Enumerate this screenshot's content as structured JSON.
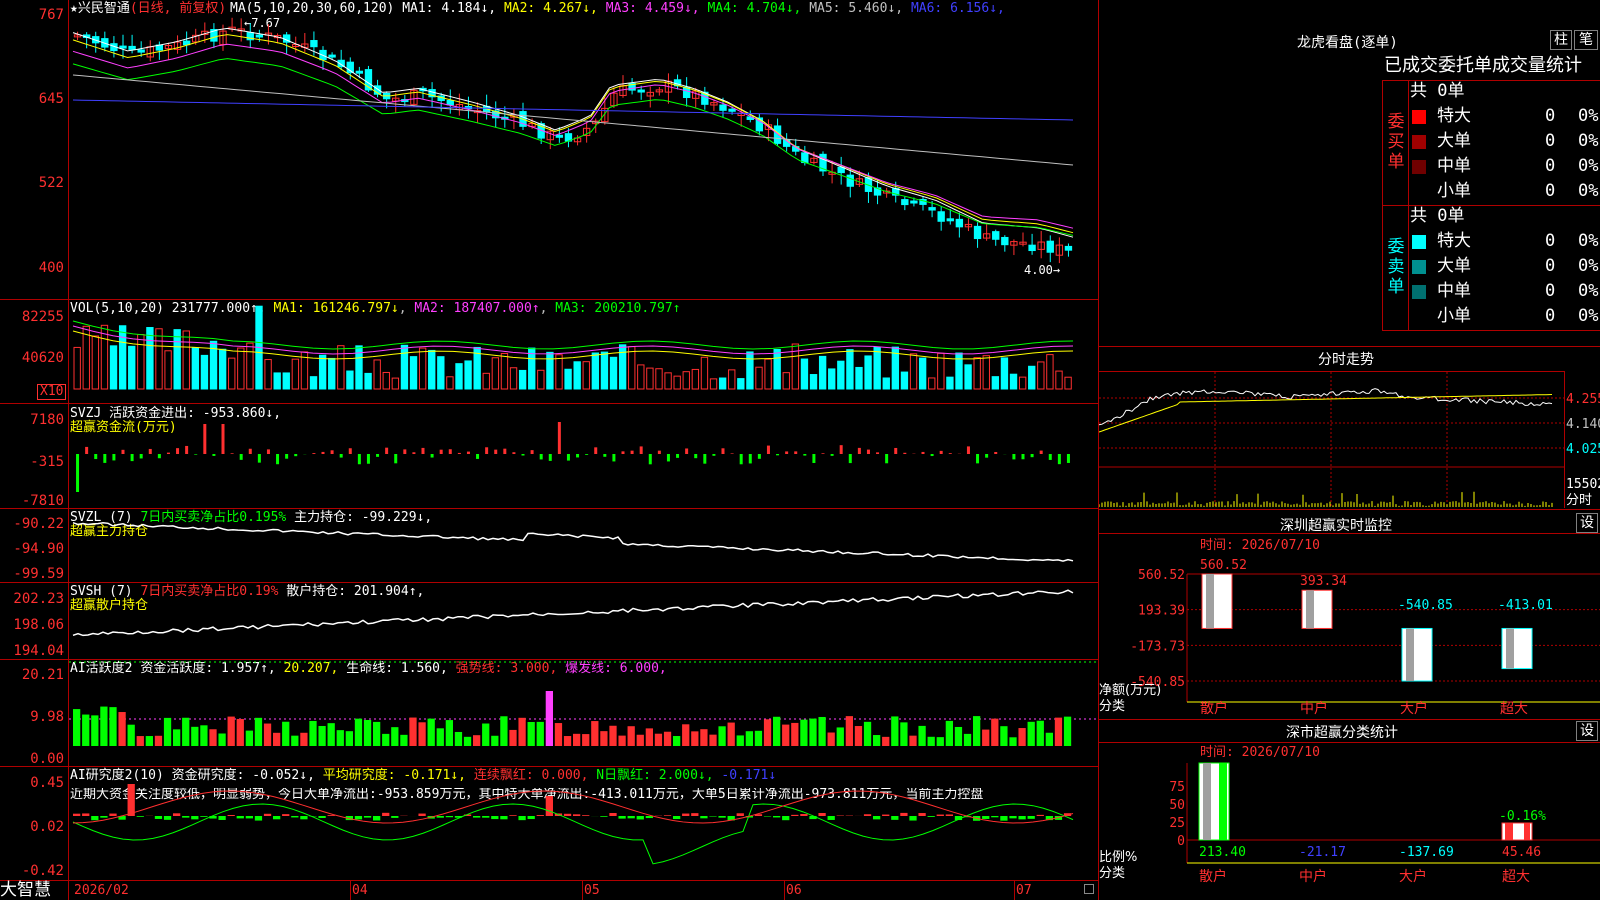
{
  "stock": {
    "star": "★",
    "name": "兴民智通",
    "period": "(日线, 前复权)"
  },
  "ma_legend": [
    {
      "label": "MA(5,10,20,30,60,120)",
      "color": "#ffffff"
    },
    {
      "label": "MA1: 4.184↓",
      "color": "#ffffff"
    },
    {
      "label": "MA2: 4.267↓",
      "color": "#ffff00"
    },
    {
      "label": "MA3: 4.459↓",
      "color": "#ff40ff"
    },
    {
      "label": "MA4: 4.704↓",
      "color": "#00ff00"
    },
    {
      "label": "MA5: 5.460↓",
      "color": "#c0c0c0"
    },
    {
      "label": "MA6: 6.156↓",
      "color": "#4040ff"
    }
  ],
  "price_axis": [
    "767",
    "645",
    "522",
    "400"
  ],
  "price_high_label": "7.67",
  "price_low_label": "4.00",
  "vol": {
    "head": "VOL(5,10,20)",
    "value": "231777.000↑",
    "ma1": "MA1: 161246.797↓",
    "ma2": "MA2: 187407.000↑",
    "ma3": "MA3: 200210.797↑",
    "axis": [
      "82255",
      "40620"
    ],
    "unit": "X10"
  },
  "svzj": {
    "head": "SVZJ",
    "label": "活跃资金进出: -953.860↓,",
    "sub": "超赢资金流(万元)",
    "axis": [
      "7180",
      "-315",
      "-7810"
    ]
  },
  "svzl": {
    "head": "SVZL (7)",
    "ratio": "7日内买卖净占比0.195%",
    "hold": "主力持仓: -99.229↓,",
    "sub": "超赢主力持仓",
    "axis": [
      "-90.22",
      "-94.90",
      "-99.59"
    ]
  },
  "svsh": {
    "head": "SVSH (7)",
    "ratio": "7日内买卖净占比0.19%",
    "hold": "散户持仓: 201.904↑,",
    "sub": "超赢散户持仓",
    "axis": [
      "202.23",
      "198.06",
      "194.04"
    ]
  },
  "ai1": {
    "head": "AI活跃度2",
    "act": "资金活跃度: 1.957↑,",
    "v2": "20.207,",
    "life": "生命线: 1.560,",
    "strong": "强势线: 3.000,",
    "burst": "爆发线: 6.000,",
    "axis": [
      "20.21",
      "9.98",
      "0.00"
    ]
  },
  "ai2": {
    "head": "AI研究度2(10)",
    "res": "资金研究度: -0.052↓,",
    "avg": "平均研究度: -0.171↓,",
    "cont": "连续飘红: 0.000,",
    "nday": "N日飘红: 2.000↓,",
    "last": "-0.171↓",
    "desc": "近期大资金关注度较低，明显弱势，今日大单净流出:-953.859万元，其中特大单净流出:-413.011万元，大单5日累计净流出-973.811万元，当前主力控盘",
    "axis": [
      "0.45",
      "0.02",
      "-0.42"
    ]
  },
  "time_axis": [
    "2026/02",
    "04",
    "05",
    "06",
    "07"
  ],
  "logo": "大智慧",
  "right": {
    "title": "龙虎看盘(逐单)",
    "btn1": "柱",
    "btn2": "笔",
    "subtitle": "已成交委托单成交量统计",
    "buy_side": "委买单",
    "sell_side": "委卖单",
    "buy_total": "共 0单",
    "sell_total": "共 0单",
    "buy_rows": [
      {
        "label": "特大",
        "n": "0",
        "p": "0%",
        "color": "#ff0000"
      },
      {
        "label": "大单",
        "n": "0",
        "p": "0%",
        "color": "#a00000"
      },
      {
        "label": "中单",
        "n": "0",
        "p": "0%",
        "color": "#700000"
      },
      {
        "label": "小单",
        "n": "0",
        "p": "0%",
        "color": "#000000"
      }
    ],
    "sell_rows": [
      {
        "label": "特大",
        "n": "0",
        "p": "0%",
        "color": "#00ffff"
      },
      {
        "label": "大单",
        "n": "0",
        "p": "0%",
        "color": "#009090"
      },
      {
        "label": "中单",
        "n": "0",
        "p": "0%",
        "color": "#007070"
      },
      {
        "label": "小单",
        "n": "0",
        "p": "0%",
        "color": "#000000"
      }
    ],
    "intraday": {
      "title": "分时走势",
      "axis": [
        "4.255",
        "4.140",
        "4.025"
      ],
      "vol": "15502",
      "vol_unit": "分时"
    },
    "monitor": {
      "title": "深圳超赢实时监控",
      "btn": "设",
      "time": "时间: 2026/07/10",
      "axis": [
        "560.52",
        "193.39",
        "-173.73",
        "-540.85"
      ],
      "bars": [
        {
          "cat": "散户",
          "value": 560.52
        },
        {
          "cat": "中户",
          "value": 393.34
        },
        {
          "cat": "大户",
          "value": -540.85
        },
        {
          "cat": "超大",
          "value": -413.01
        }
      ],
      "yl1": "净额(万元)",
      "yl2": "分类"
    },
    "stats": {
      "title": "深市超赢分类统计",
      "btn": "设",
      "time": "时间: 2026/07/10",
      "axis": [
        "75",
        "50",
        "25",
        "0"
      ],
      "pct_label": "-0.16%",
      "bars": [
        {
          "cat": "散户",
          "value": "213.40"
        },
        {
          "cat": "中户",
          "value": "-21.17"
        },
        {
          "cat": "大户",
          "value": "-137.69"
        },
        {
          "cat": "超大",
          "value": "45.46"
        }
      ],
      "yl1": "比例%",
      "yl2": "分类"
    }
  }
}
